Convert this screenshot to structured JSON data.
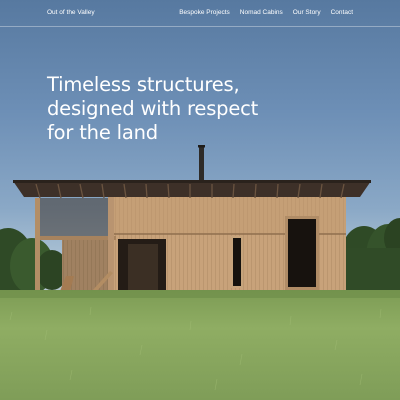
{
  "brand": {
    "name": "Out of the Valley"
  },
  "nav": {
    "items": [
      {
        "label": "Bespoke Projects"
      },
      {
        "label": "Nomad Cabins"
      },
      {
        "label": "Our Story"
      },
      {
        "label": "Contact"
      }
    ]
  },
  "hero": {
    "headline_lines": [
      "Timeless structures,",
      "designed with respect",
      "for the land"
    ]
  },
  "colors": {
    "sky_top": "#5779a0",
    "sky_bottom": "#b7c8d1",
    "cedar": "#c9a57e",
    "field": "#88a65c",
    "text": "#ffffff"
  }
}
